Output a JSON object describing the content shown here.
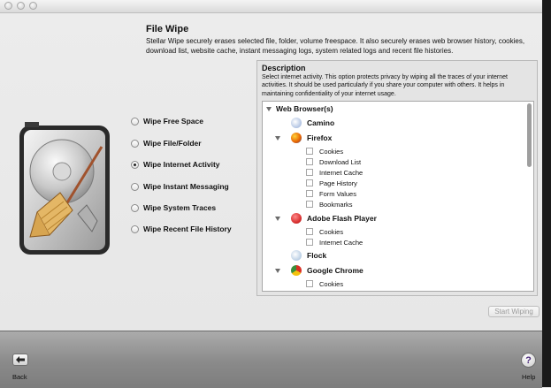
{
  "header": {
    "title": "File Wipe",
    "subtitle": "Stellar Wipe securely erases selected file, folder, volume freespace. It also securely erases web browser history, cookies, download list, website cache, instant messaging logs, system related logs and recent file histories."
  },
  "options": [
    {
      "label": "Wipe Free Space",
      "selected": false
    },
    {
      "label": "Wipe File/Folder",
      "selected": false
    },
    {
      "label": "Wipe Internet Activity",
      "selected": true
    },
    {
      "label": "Wipe Instant Messaging",
      "selected": false
    },
    {
      "label": "Wipe System Traces",
      "selected": false
    },
    {
      "label": "Wipe Recent File History",
      "selected": false
    }
  ],
  "description": {
    "title": "Description",
    "text": "Select internet activity. This option protects privacy by wiping all the traces of your internet activities. It should be used particularly if you share your computer with others. It helps in maintaining confidentiality of your internet usage."
  },
  "tree": {
    "root": "Web Browser(s)",
    "browsers": [
      {
        "name": "Camino",
        "icon": "camino-icon",
        "items": []
      },
      {
        "name": "Firefox",
        "icon": "firefox-icon",
        "items": [
          "Cookies",
          "Download List",
          "Internet Cache",
          "Page History",
          "Form Values",
          "Bookmarks"
        ]
      },
      {
        "name": "Adobe Flash Player",
        "icon": "flash-player-icon",
        "items": [
          "Cookies",
          "Internet Cache"
        ]
      },
      {
        "name": "Flock",
        "icon": "flock-icon",
        "items": []
      },
      {
        "name": "Google Chrome",
        "icon": "chrome-icon",
        "items": [
          "Cookies"
        ]
      }
    ]
  },
  "actions": {
    "start_label": "Start Wiping"
  },
  "footer": {
    "back_label": "Back",
    "help_label": "Help",
    "help_glyph": "?"
  },
  "colors": {
    "firefox": "#e66000",
    "flash": "#d62b2b",
    "chrome": "#3a8e3a",
    "camino": "#8fa9d6",
    "flock": "#9bb9d9"
  }
}
